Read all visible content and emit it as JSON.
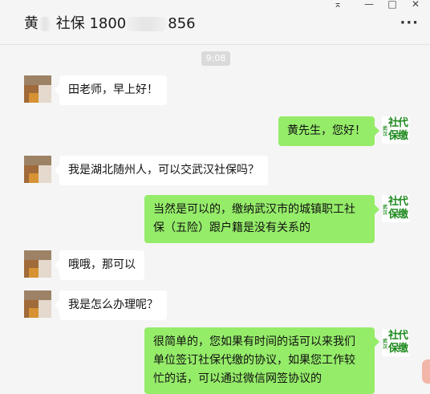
{
  "header": {
    "title_prefix": "黄",
    "title_mid": " 社保 1800",
    "title_suffix": "856",
    "controls": {
      "pin_icon": "pin-icon",
      "minimize": "—",
      "maximize": "□",
      "close": "✕"
    },
    "more": "···"
  },
  "chat": {
    "time": "9:08",
    "messages": [
      {
        "side": "in",
        "text": "田老师，早上好！"
      },
      {
        "side": "out",
        "text": "黄先生，您好！"
      },
      {
        "side": "in",
        "text": "我是湖北随州人，可以交武汉社保吗？"
      },
      {
        "side": "out",
        "text": "当然是可以的，缴纳武汉市的城镇职工社保（五险）跟户籍是没有关系的"
      },
      {
        "side": "in",
        "text": "哦哦，那可以"
      },
      {
        "side": "in",
        "text": "我是怎么办理呢？"
      },
      {
        "side": "out",
        "text": "很简单的，您如果有时间的话可以来我们单位签订社保代缴的协议，如果您工作较忙的话，可以通过微信网签协议的"
      }
    ],
    "agent_avatar": {
      "small": "武汉",
      "big": "社代保缴"
    }
  },
  "colors": {
    "out_bubble": "#95ec69",
    "in_bubble": "#ffffff",
    "background": "#f5f5f5"
  }
}
